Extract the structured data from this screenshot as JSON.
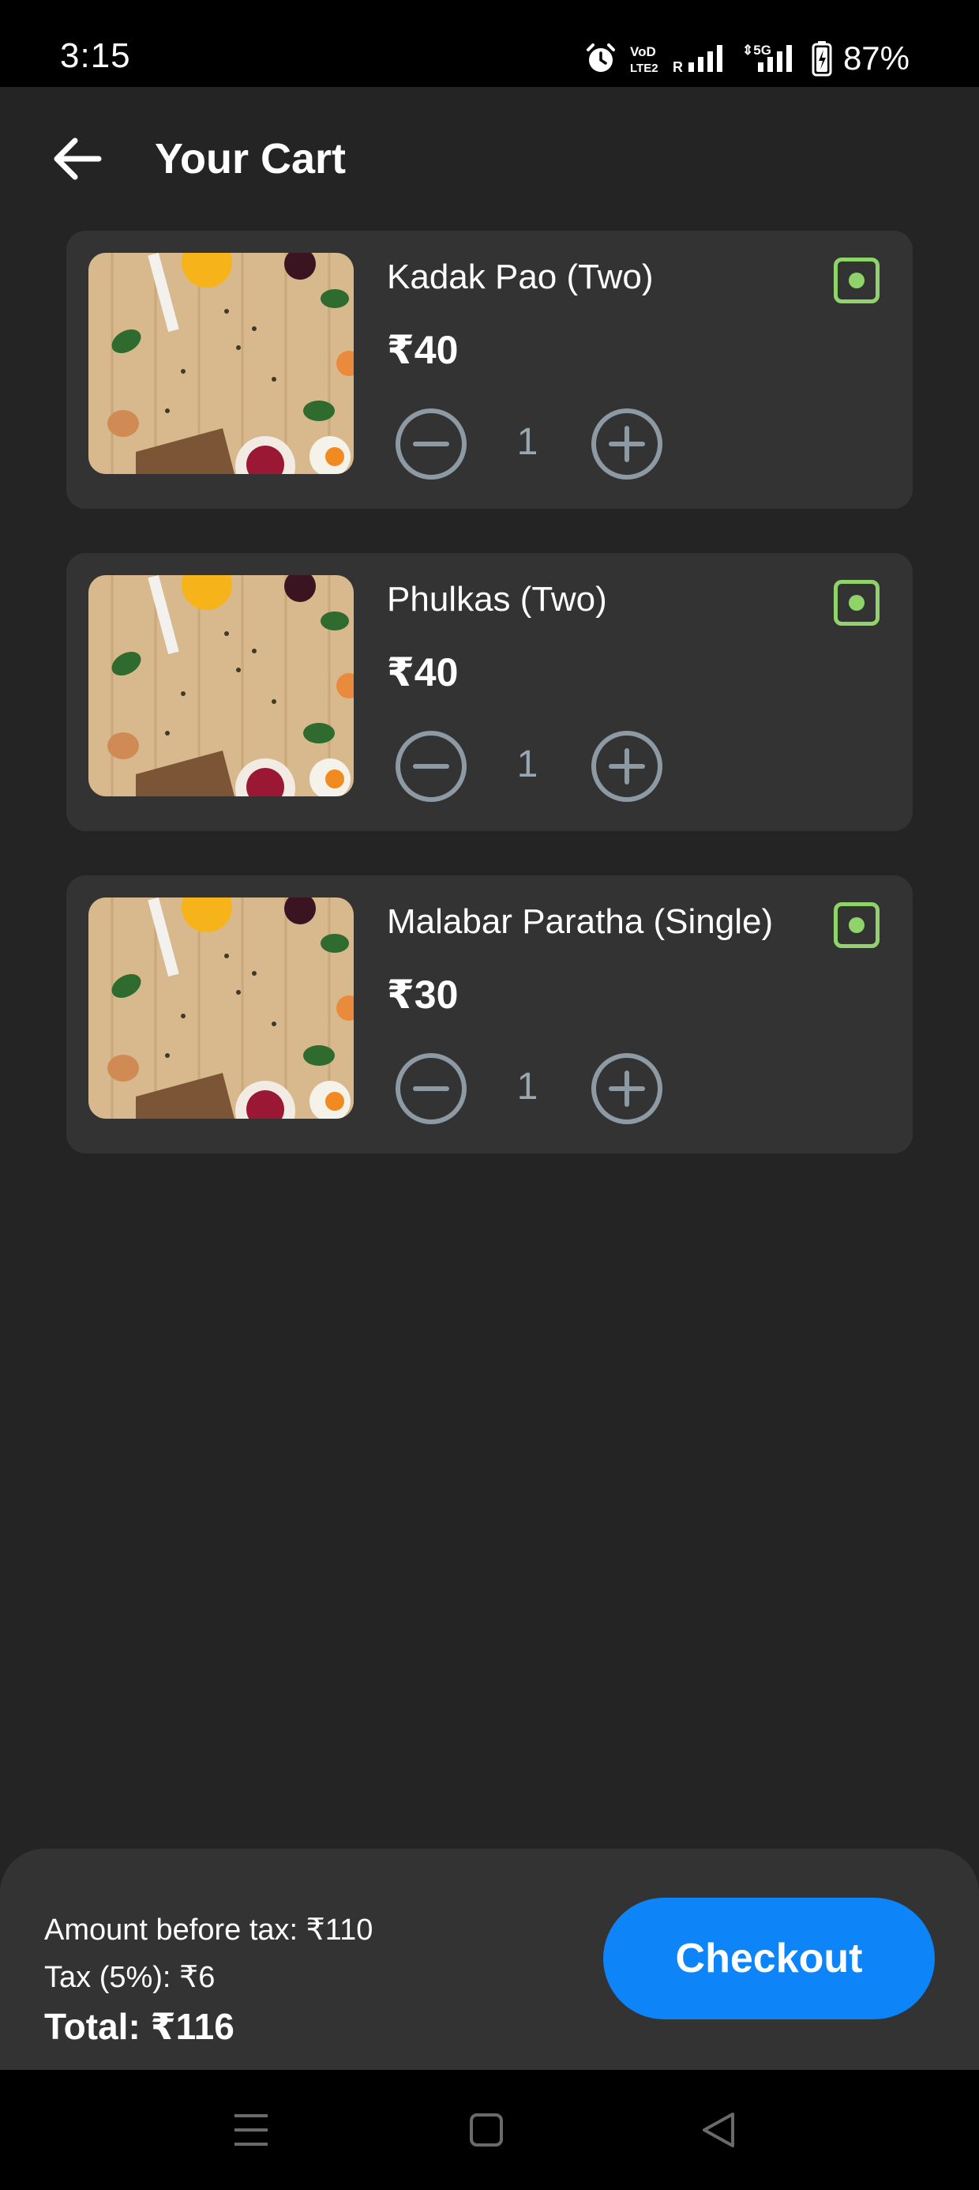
{
  "status_bar": {
    "time": "3:15",
    "battery": "87%",
    "icons": [
      "alarm-icon",
      "volte-icon",
      "signal-icon",
      "5g-signal-icon",
      "battery-icon"
    ]
  },
  "header": {
    "title": "Your Cart",
    "back_icon": "arrow-left-icon"
  },
  "cart": {
    "items": [
      {
        "name": "Kadak Pao (Two)",
        "price": "₹40",
        "quantity": "1"
      },
      {
        "name": "Phulkas (Two)",
        "price": "₹40",
        "quantity": "1"
      },
      {
        "name": "Malabar Paratha (Single)",
        "price": "₹30",
        "quantity": "1"
      }
    ],
    "veg_indicator_color": "#8fd36a"
  },
  "summary": {
    "amount_before_tax": "Amount before tax: ₹110",
    "tax": "Tax (5%): ₹6",
    "total": "Total: ₹116",
    "checkout_label": "Checkout"
  },
  "nav_bar": {
    "icons": [
      "menu-icon",
      "home-square-icon",
      "back-triangle-icon"
    ]
  },
  "colors": {
    "background": "#242424",
    "card": "#333333",
    "accent": "#0d84f7",
    "veg": "#8fd36a",
    "muted": "#9aa7b0"
  }
}
